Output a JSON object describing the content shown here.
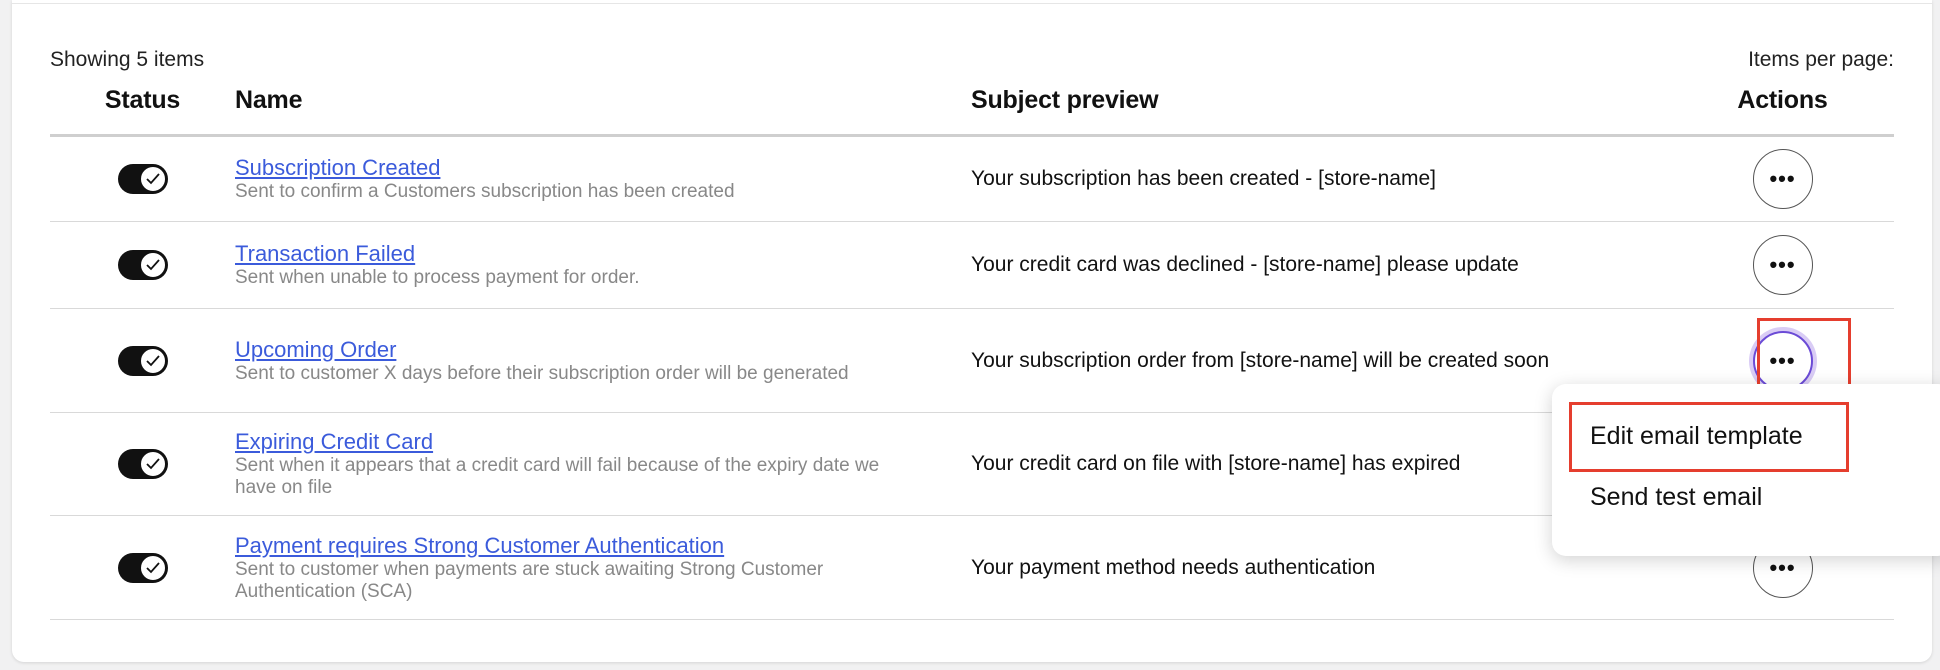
{
  "header": {
    "showing_text": "Showing 5 items",
    "items_per_page_label": "Items per page:"
  },
  "table": {
    "columns": [
      "Status",
      "Name",
      "Subject preview",
      "Actions"
    ],
    "rows": [
      {
        "status": "on",
        "name": "Subscription Created",
        "description": "Sent to confirm a Customers subscription has been created",
        "subject": "Your subscription has been created - [store-name]",
        "actions_label": "•••"
      },
      {
        "status": "on",
        "name": "Transaction Failed",
        "description": "Sent when unable to process payment for order.",
        "subject": "Your credit card was declined - [store-name] please update",
        "actions_label": "•••"
      },
      {
        "status": "on",
        "name": "Upcoming Order",
        "description": "Sent to customer X days before their subscription order will be generated",
        "subject": "Your subscription order from [store-name] will be created soon",
        "actions_label": "•••"
      },
      {
        "status": "on",
        "name": "Expiring Credit Card",
        "description": "Sent when it appears that a credit card will fail because of the expiry date we have on file",
        "subject": "Your credit card on file with [store-name] has expired",
        "actions_label": "•••"
      },
      {
        "status": "on",
        "name": "Payment requires Strong Customer Authentication",
        "description": "Sent to customer when payments are stuck awaiting Strong Customer Authentication (SCA)",
        "subject": "Your payment method needs authentication",
        "actions_label": "•••"
      }
    ]
  },
  "actions_menu": {
    "items": [
      "Edit email template",
      "Send test email"
    ]
  },
  "colors": {
    "link": "#3b5bdb",
    "highlight": "#e53e2e",
    "active_ring": "#6b4bd6"
  },
  "icons": {
    "toggle_check": "check-icon",
    "actions": "more-horizontal-icon"
  }
}
